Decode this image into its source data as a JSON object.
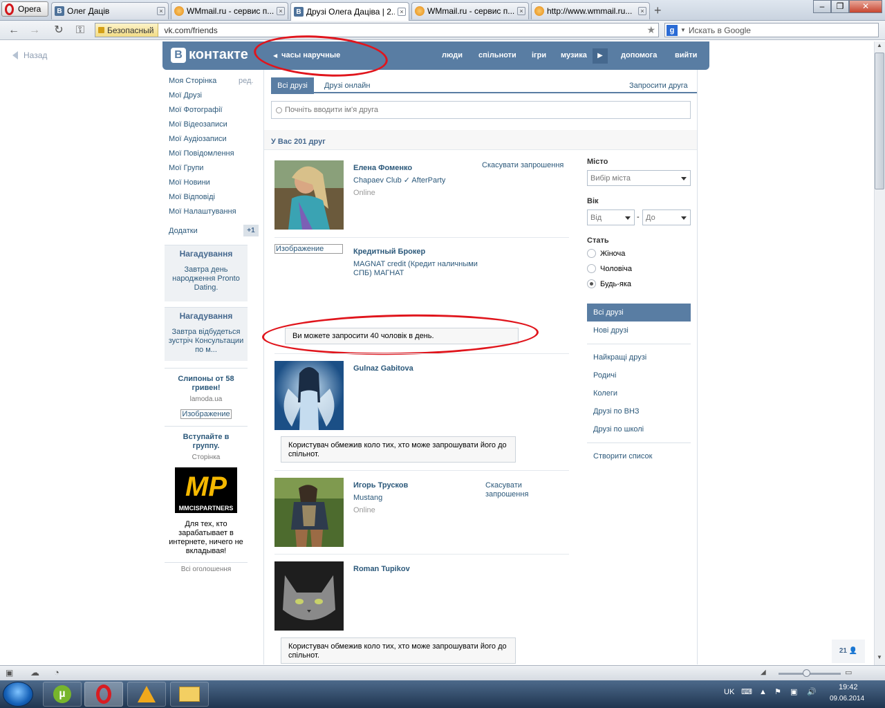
{
  "browser": {
    "menu_label": "Opera",
    "tabs": [
      {
        "title": "Олег Дацiв",
        "icon": "vk"
      },
      {
        "title": "WMmail.ru - сервис п...",
        "icon": "wmmail"
      },
      {
        "title": "Друзі Олега Даціва | 2...",
        "icon": "vk",
        "active": true
      },
      {
        "title": "WMmail.ru - сервис п...",
        "icon": "wmmail"
      },
      {
        "title": "http://www.wmmail.ru...",
        "icon": "wmmail"
      }
    ],
    "secure_label": "Безопасный",
    "url": "vk.com/friends",
    "search_placeholder": "Искать в Google"
  },
  "page": {
    "back_label": "Назад",
    "logo_text": "контакте",
    "header_query": "часы наручные",
    "nav": [
      "люди",
      "спільноти",
      "ігри",
      "музика",
      "допомога",
      "вийти"
    ],
    "left_menu": {
      "items": [
        "Моя Сторінка",
        "Мої Друзі",
        "Мої Фотографії",
        "Мої Відеозаписи",
        "Мої Аудіозаписи",
        "Мої Повідомлення",
        "Мої Групи",
        "Мої Новини",
        "Мої Відповіді",
        "Мої Налаштування"
      ],
      "edit_label": "ред.",
      "apps_label": "Додатки",
      "apps_badge": "+1"
    },
    "reminders": [
      {
        "title": "Нагадування",
        "link1": "Завтра",
        "text": " день народження ",
        "link2": "Pronto Dating",
        "tail": "."
      },
      {
        "title": "Нагадування",
        "link1": "Завтра",
        "text": " відбудеться зустріч ",
        "link2": "Консультации по м...",
        "tail": ""
      }
    ],
    "ads": [
      {
        "title": "Слипоны от 58 гривен!",
        "source": "lamoda.ua",
        "image_alt": "Изображение"
      },
      {
        "title": "Вступайте в группу.",
        "source": "Сторінка",
        "logo_text": "MP",
        "logo_sub": "MMCISPARTNERS",
        "text": "Для тех, кто зарабатывает в интернете, ничего не вкладывая!"
      }
    ],
    "all_ads_label": "Всі оголошення",
    "tabs": [
      "Всі друзі",
      "Друзі онлайн"
    ],
    "invite_label": "Запросити друга",
    "search_placeholder": "Почніть вводити ім'я друга",
    "friend_count_label": "У Вас 201 друг",
    "friends": [
      {
        "name": "Елена Фоменко",
        "info": "Chapaev Club ✓ AfterParty",
        "status": "Online",
        "action": "Скасувати запрошення"
      },
      {
        "name": "Кредитный Брокер",
        "info": "MAGNAT credit (Кредит наличными СПБ) МАГНАТ",
        "image_alt": "Изображение",
        "notice": "Ви можете запросити 40 чоловік в день."
      },
      {
        "name": "Gulnaz Gabitova",
        "notice": "Користувач обмежив коло тих, хто може запрошувати його до спільнот."
      },
      {
        "name": "Игорь Трусков",
        "info": "Mustang",
        "status": "Online",
        "action": "Скасувати запрошення"
      },
      {
        "name": "Roman Tupikov",
        "notice": "Користувач обмежив коло тих, хто може запрошувати його до спільнот."
      }
    ],
    "filters": {
      "city_label": "Місто",
      "city_placeholder": "Вибір міста",
      "age_label": "Вік",
      "age_from": "Від",
      "age_to": "До",
      "age_dash": "-",
      "sex_label": "Стать",
      "sex_options": [
        "Жіноча",
        "Чоловіча",
        "Будь-яка"
      ],
      "sex_selected": "Будь-яка",
      "lists": [
        "Всі друзі",
        "Нові друзі"
      ],
      "groups": [
        "Найкращі друзі",
        "Родичі",
        "Колеги",
        "Друзі по ВНЗ",
        "Друзі по школі"
      ],
      "create_list": "Створити список"
    },
    "online_counter": "21"
  },
  "taskbar": {
    "lang": "UK",
    "time": "19:42",
    "date": "09.06.2014"
  }
}
